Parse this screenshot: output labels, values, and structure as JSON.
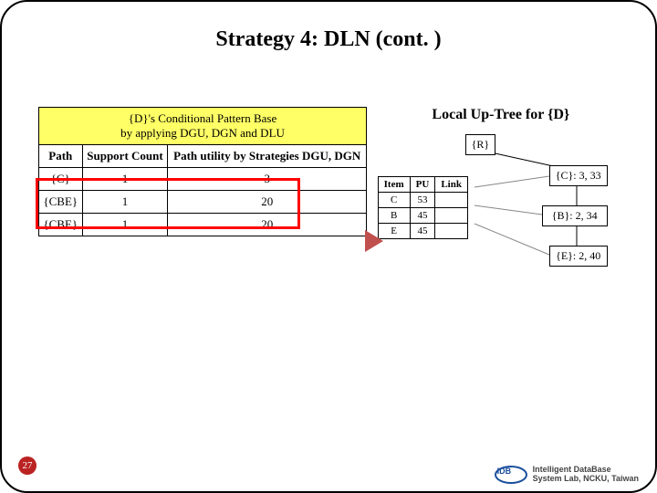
{
  "slide": {
    "title": "Strategy 4: DLN (cont. )",
    "page_number": "27"
  },
  "cpb": {
    "header_l1": "{D}'s Conditional Pattern Base",
    "header_l2": "by applying DGU, DGN and DLU",
    "cols": {
      "path": "Path",
      "support": "Support Count",
      "utility": "Path utility by Strategies DGU, DGN"
    },
    "rows": [
      {
        "path": "{C}",
        "support": "1",
        "utility": "3"
      },
      {
        "path": "{CBE}",
        "support": "1",
        "utility": "20"
      },
      {
        "path": "{CBE}",
        "support": "1",
        "utility": "20"
      }
    ]
  },
  "uptree": {
    "title": "Local Up-Tree for {D}",
    "root": "{R}",
    "nodes": {
      "c": "{C}: 3, 33",
      "b": "{B}: 2, 34",
      "e": "{E}: 2, 40"
    },
    "item_cols": {
      "item": "Item",
      "pu": "PU",
      "link": "Link"
    },
    "items": [
      {
        "item": "C",
        "pu": "53",
        "link": ""
      },
      {
        "item": "B",
        "pu": "45",
        "link": ""
      },
      {
        "item": "E",
        "pu": "45",
        "link": ""
      }
    ]
  },
  "footer": {
    "line1": "Intelligent DataBase",
    "line2": "System Lab, NCKU, Taiwan",
    "logo_text": "IDB"
  }
}
